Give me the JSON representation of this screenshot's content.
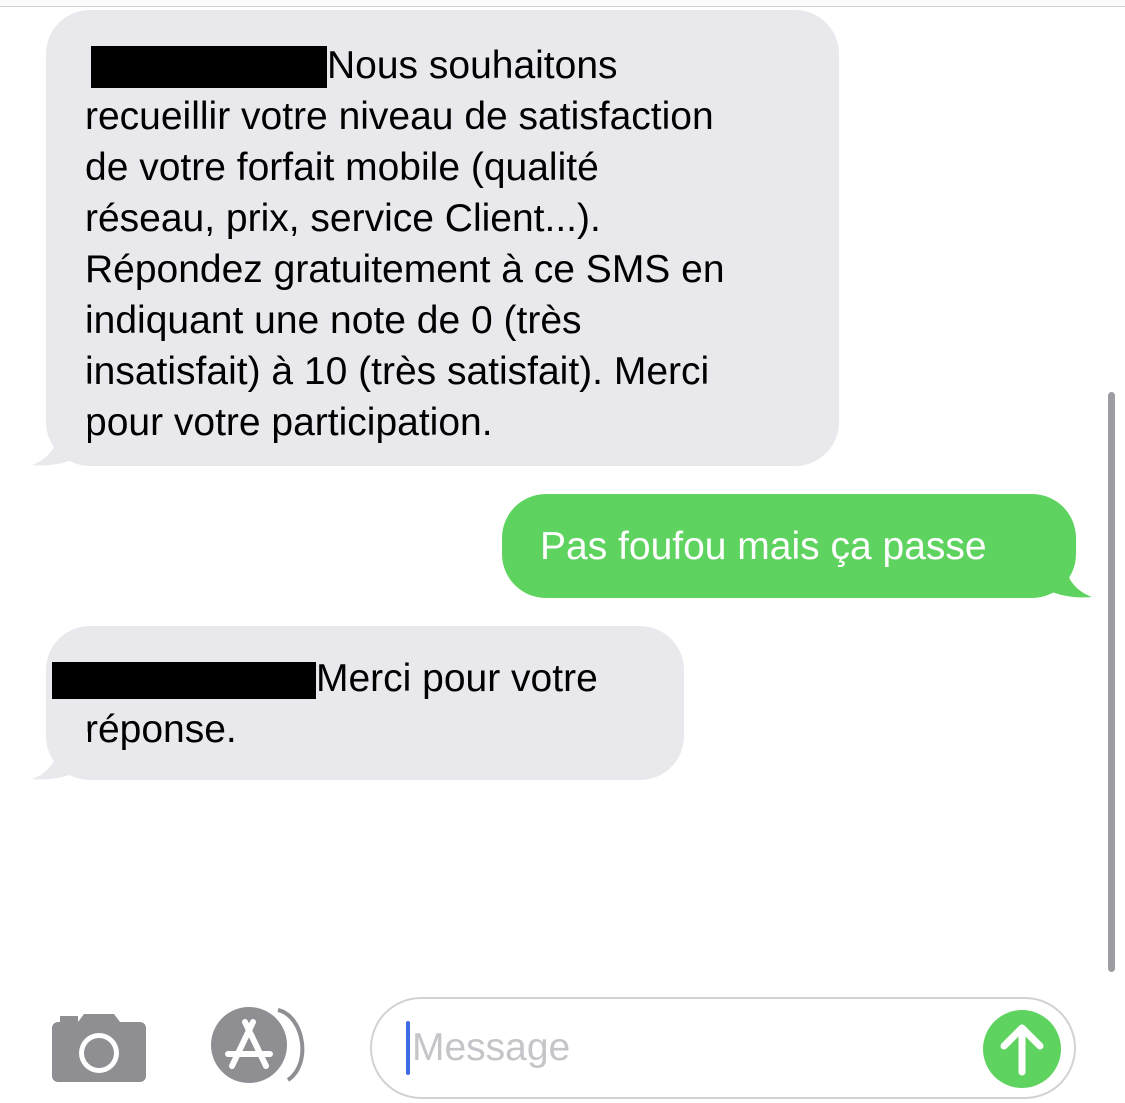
{
  "conversation": {
    "messages": [
      {
        "direction": "incoming",
        "lines": [
          "Nous souhaitons",
          "recueillir votre niveau de satisfaction",
          "de votre forfait mobile (qualité",
          "réseau, prix, service Client...).",
          "Répondez gratuitement à ce SMS en",
          "indiquant une note de 0 (très",
          "insatisfait) à 10 (très satisfait). Merci",
          "pour votre participation."
        ]
      },
      {
        "direction": "outgoing",
        "lines": [
          "Pas foufou mais ça passe"
        ]
      },
      {
        "direction": "incoming",
        "lines": [
          "Merci pour votre",
          "réponse."
        ]
      }
    ]
  },
  "toolbar": {
    "camera_icon": "camera-icon",
    "app_store_icon": "app-store-icon"
  },
  "composer": {
    "placeholder": "Message",
    "send_icon": "arrow-up-icon"
  },
  "colors": {
    "incoming_bubble": "#e8e8ed",
    "outgoing_bubble": "#5fd35f",
    "send_button": "#5fd35f",
    "icon_gray": "#8e8e93"
  }
}
